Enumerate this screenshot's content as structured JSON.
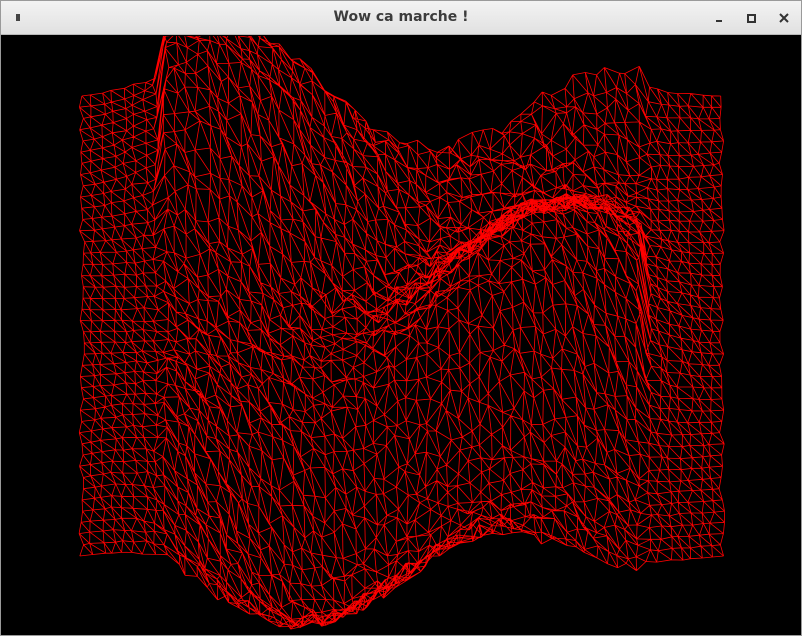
{
  "window": {
    "title": "Wow ca marche !"
  },
  "controls": {
    "menu_icon": "window-menu-icon",
    "minimize_icon": "minimize-icon",
    "maximize_icon": "maximize-icon",
    "close_icon": "close-icon"
  },
  "render": {
    "background_color": "#000000",
    "wire_color": "#ff0000"
  }
}
